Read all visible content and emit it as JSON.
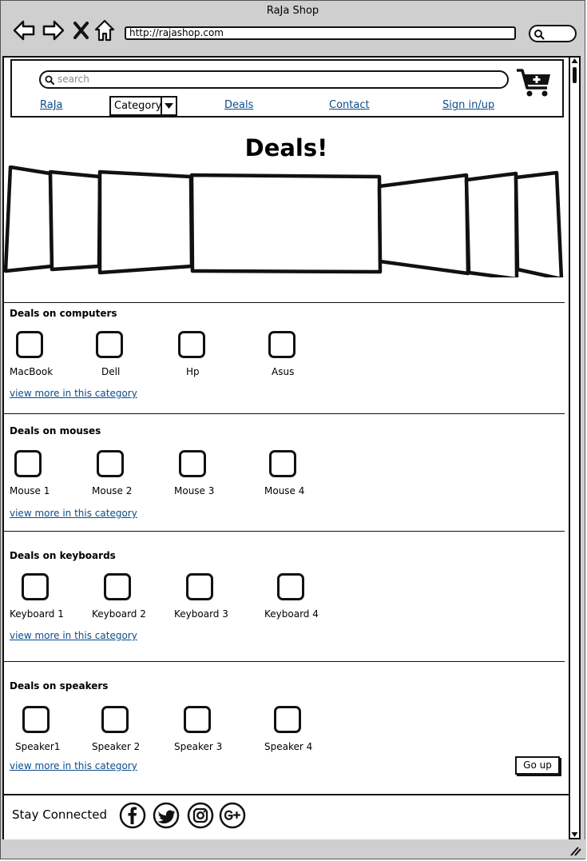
{
  "window": {
    "title": "RaJa Shop"
  },
  "browser": {
    "url": "http://rajashop.com"
  },
  "header": {
    "search_placeholder": "search",
    "nav": {
      "home": "RaJa",
      "category": "Category",
      "deals": "Deals",
      "contact": "Contact",
      "sign_in": "Sign in/up"
    }
  },
  "main": {
    "title": "Deals!",
    "sections": [
      {
        "title": "Deals on computers",
        "items": [
          "MacBook",
          "Dell",
          "Hp",
          "Asus"
        ],
        "more_link": "view more in this category"
      },
      {
        "title": "Deals on mouses",
        "items": [
          "Mouse 1",
          "Mouse 2",
          "Mouse 3",
          "Mouse 4"
        ],
        "more_link": "view more in this category"
      },
      {
        "title": "Deals on keyboards",
        "items": [
          "Keyboard 1",
          "Keyboard 2",
          "Keyboard 3",
          "Keyboard 4"
        ],
        "more_link": "view more in this category"
      },
      {
        "title": "Deals on speakers",
        "items": [
          "Speaker1",
          "Speaker 2",
          "Speaker 3",
          "Speaker 4"
        ],
        "more_link": "view more in this category"
      }
    ],
    "go_up_label": "Go up"
  },
  "footer": {
    "stay_connected": "Stay Connected",
    "social_icons": [
      "facebook-icon",
      "twitter-icon",
      "instagram-icon",
      "google-plus-icon"
    ]
  },
  "colors": {
    "link": "#0b4c8c",
    "chrome": "#cfcfcf",
    "ink": "#111111"
  }
}
